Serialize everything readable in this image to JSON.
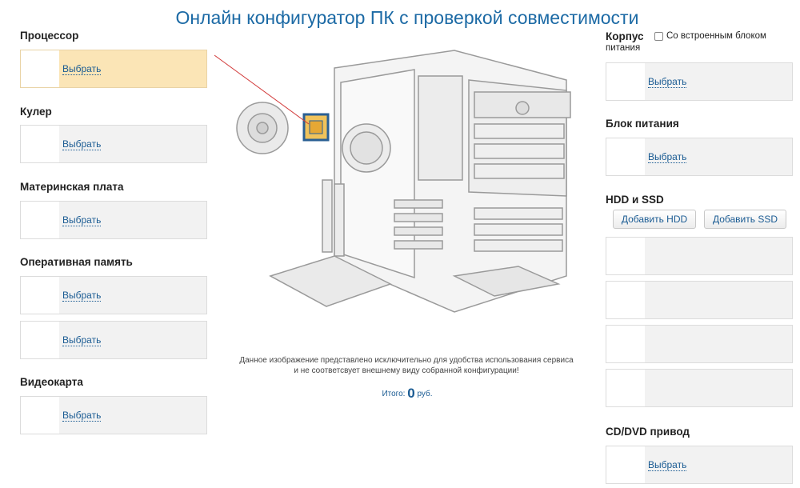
{
  "title": "Онлайн конфигуратор ПК с проверкой совместимости",
  "choose_label": "Выбрать",
  "left": {
    "cpu": "Процессор",
    "cooler": "Кулер",
    "motherboard": "Материнская плата",
    "ram": "Оперативная память",
    "gpu": "Видеокарта"
  },
  "right": {
    "case": "Корпус",
    "case_checkbox_line1": "Со встроенным блоком",
    "case_checkbox_line2": "питания",
    "psu": "Блок питания",
    "storage": "HDD и SSD",
    "add_hdd": "Добавить HDD",
    "add_ssd": "Добавить SSD",
    "optical": "CD/DVD привод"
  },
  "note_line1": "Данное изображение представлено исключительно для удобства использования сервиса",
  "note_line2": "и не соответсвует внешнему виду собранной конфигурации!",
  "total_label": "Итого:",
  "total_value": "0",
  "total_currency": "руб.",
  "colors": {
    "accent": "#1c6aa5",
    "active_slot": "#fbe5b6",
    "slot_bg": "#f2f2f2"
  }
}
